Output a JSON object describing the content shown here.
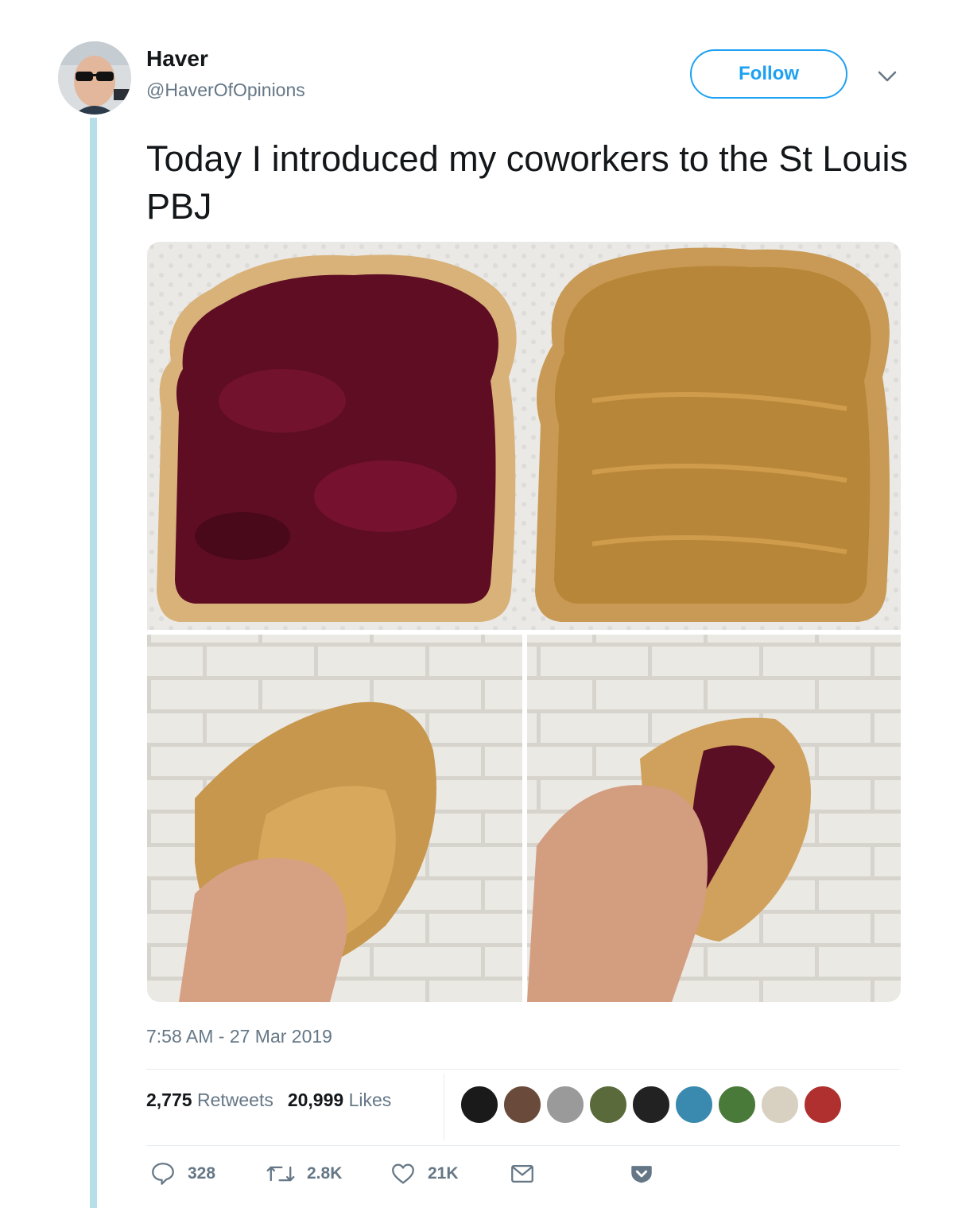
{
  "author": {
    "name": "Haver",
    "handle": "@HaverOfOpinions",
    "avatar_icon": "profile-photo"
  },
  "header": {
    "follow_label": "Follow",
    "menu_icon": "chevron-down-icon"
  },
  "tweet": {
    "text": "Today I introduced my coworkers to the St Louis PBJ",
    "timestamp": "7:58 AM - 27 Mar 2019",
    "media_count": 3
  },
  "stats": {
    "retweets_count": "2,775",
    "retweets_label": "Retweets",
    "likes_count": "20,999",
    "likes_label": "Likes"
  },
  "actions": {
    "reply_count": "328",
    "retweet_count": "2.8K",
    "like_count": "21K"
  },
  "colors": {
    "accent": "#1da1f2",
    "muted": "#657786",
    "thread": "#b6dee9"
  }
}
